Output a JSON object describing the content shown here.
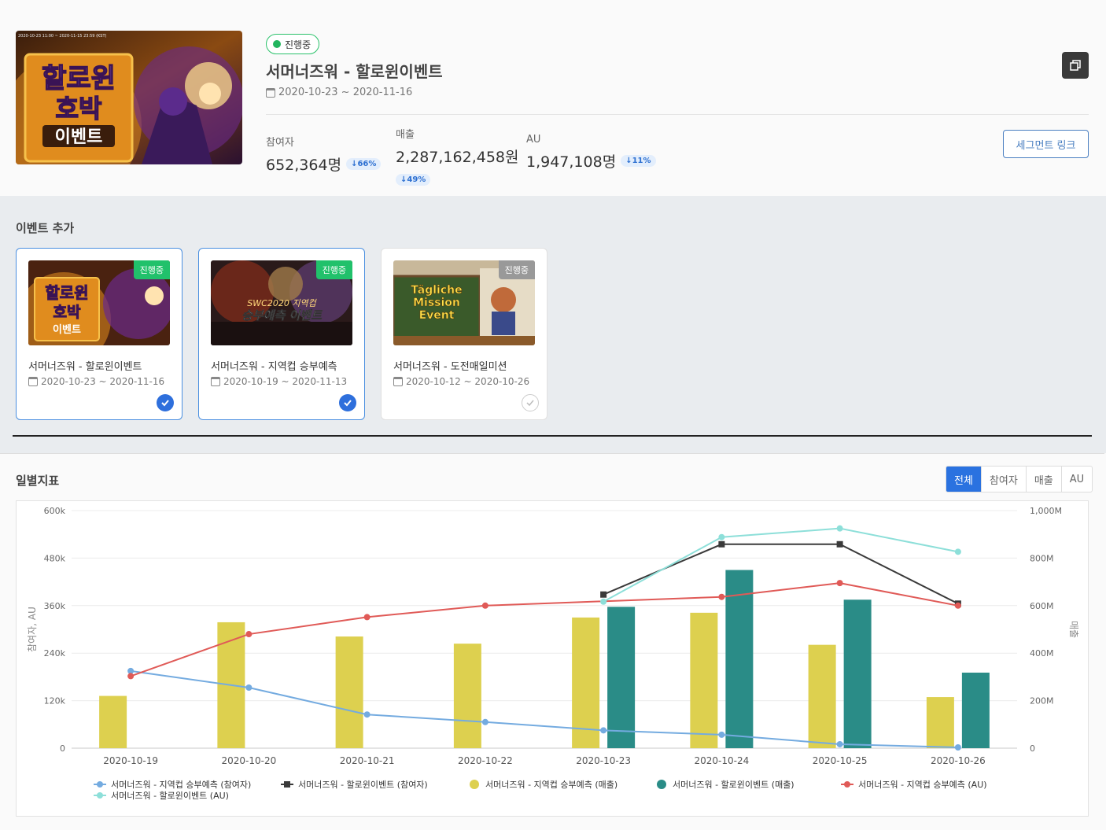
{
  "header": {
    "status": "진행중",
    "title": "서머너즈워 - 할로윈이벤트",
    "dates": "2020-10-23 ~ 2020-11-16",
    "banner": {
      "line1": "할로윈",
      "line2": "호박",
      "line3": "이벤트",
      "small_text": "2020-10-23 11:00 ~ 2020-11-15 23:59 (KST)"
    },
    "metrics": [
      {
        "label": "참여자",
        "value": "652,364명",
        "delta": "66%",
        "direction": "down"
      },
      {
        "label": "매출",
        "value": "2,287,162,458원",
        "delta": "49%",
        "direction": "down"
      },
      {
        "label": "AU",
        "value": "1,947,108명",
        "delta": "11%",
        "direction": "down"
      }
    ],
    "segment_button": "세그먼트 링크"
  },
  "event_add": {
    "title": "이벤트 추가",
    "cards": [
      {
        "name": "서머너즈워 - 할로윈이벤트",
        "dates": "2020-10-23 ~ 2020-11-16",
        "badge": "진행중",
        "thumb_text": "할로윈 호박 이벤트",
        "selected": true
      },
      {
        "name": "서머너즈워 - 지역컵 승부예측",
        "dates": "2020-10-19 ~ 2020-11-13",
        "badge": "진행중",
        "thumb_text": "SWC2020 지역컵 승부예측 이벤트",
        "selected": true
      },
      {
        "name": "서머너즈워 - 도전매일미션",
        "dates": "2020-10-12 ~ 2020-10-26",
        "badge": "진행중",
        "thumb_text": "Tägliche Mission Event",
        "selected": false
      }
    ]
  },
  "daily": {
    "title": "일별지표",
    "tabs": [
      "전체",
      "참여자",
      "매출",
      "AU"
    ],
    "active_tab": "전체"
  },
  "colors": {
    "accent": "#2a72e0",
    "green": "#21c16b",
    "bar_yellow": "#ddd04f",
    "bar_teal": "#2a8c87",
    "line_blue": "#74abe0",
    "line_black": "#3a3a3a",
    "line_red": "#e05a57",
    "line_cyan": "#8ddfd9"
  },
  "chart_data": {
    "type": "bar",
    "categories": [
      "2020-10-19",
      "2020-10-20",
      "2020-10-21",
      "2020-10-22",
      "2020-10-23",
      "2020-10-24",
      "2020-10-25",
      "2020-10-26"
    ],
    "ylabel_left": "참여자, AU",
    "ylabel_right": "매출",
    "ylim_left": [
      0,
      600000
    ],
    "ylim_right": [
      0,
      1000000000
    ],
    "left_ticks": [
      "0",
      "120k",
      "240k",
      "360k",
      "480k",
      "600k"
    ],
    "right_ticks": [
      "0",
      "200M",
      "400M",
      "600M",
      "800M",
      "1,000M"
    ],
    "bar_series": [
      {
        "name": "서머너즈워 - 지역컵 승부예측 (매출)",
        "color": "#ddd04f",
        "axis": "right",
        "values": [
          220000000,
          530000000,
          470000000,
          440000000,
          550000000,
          570000000,
          435000000,
          215000000
        ]
      },
      {
        "name": "서머너즈워 - 할로윈이벤트 (매출)",
        "color": "#2a8c87",
        "axis": "right",
        "values": [
          null,
          null,
          null,
          null,
          595000000,
          750000000,
          625000000,
          318000000
        ]
      }
    ],
    "line_series": [
      {
        "name": "서머너즈워 - 지역컵 승부예측 (참여자)",
        "color": "#74abe0",
        "marker": "circle",
        "values": [
          195000,
          153000,
          85000,
          66000,
          45000,
          34000,
          10000,
          2000
        ]
      },
      {
        "name": "서머너즈워 - 할로윈이벤트 (참여자)",
        "color": "#3a3a3a",
        "marker": "square",
        "values": [
          null,
          null,
          null,
          null,
          388000,
          515000,
          515000,
          365000
        ]
      },
      {
        "name": "서머너즈워 - 지역컵 승부예측 (AU)",
        "color": "#e05a57",
        "marker": "circle",
        "values": [
          182000,
          288000,
          331000,
          360000,
          null,
          382000,
          417000,
          360000
        ]
      },
      {
        "name": "서머너즈워 - 할로윈이벤트 (AU)",
        "color": "#8ddfd9",
        "marker": "circle",
        "values": [
          null,
          null,
          null,
          null,
          370000,
          533000,
          555000,
          496000
        ]
      }
    ],
    "legend_position": "bottom",
    "grid": true
  }
}
